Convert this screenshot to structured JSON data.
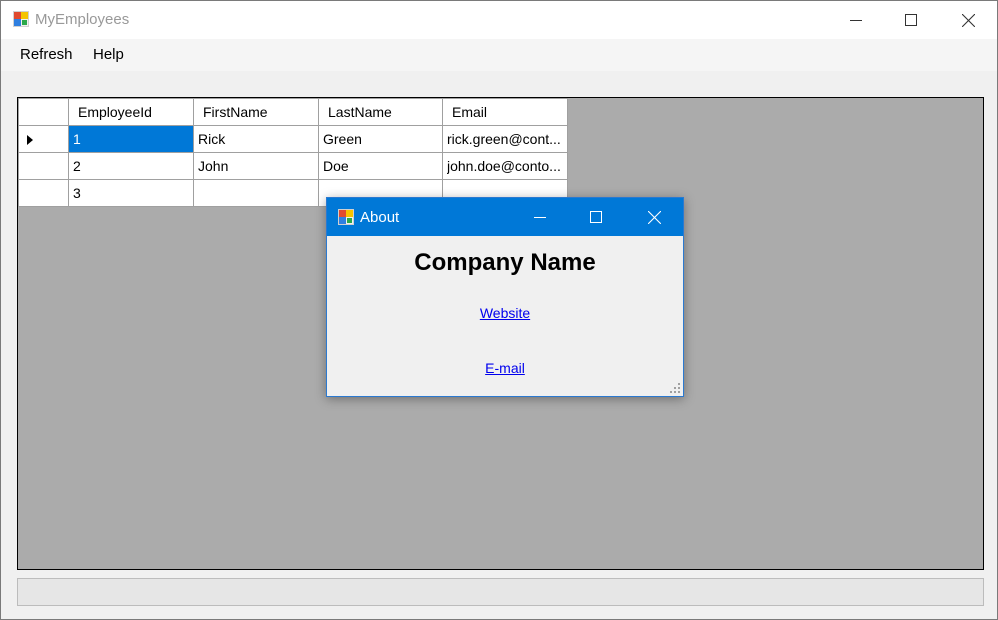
{
  "window": {
    "title": "MyEmployees"
  },
  "menu": {
    "items": [
      "Refresh",
      "Help"
    ]
  },
  "grid": {
    "columns": [
      "EmployeeId",
      "FirstName",
      "LastName",
      "Email"
    ],
    "rows": [
      {
        "id": "1",
        "first": "Rick",
        "last": "Green",
        "email": "rick.green@cont..."
      },
      {
        "id": "2",
        "first": "John",
        "last": "Doe",
        "email": "john.doe@conto..."
      },
      {
        "id": "3",
        "first": "",
        "last": "",
        "email": ""
      }
    ],
    "selected_row": 0
  },
  "dialog": {
    "title": "About",
    "company": "Company Name",
    "website_label": "Website",
    "email_label": "E-mail"
  },
  "colors": {
    "accent": "#0078d7",
    "grid_background": "#ababab",
    "link": "#0000ee"
  },
  "icons": {
    "app": "app-window-icon",
    "minimize": "minimize-icon",
    "maximize": "maximize-icon",
    "close": "close-icon",
    "row_pointer": "row-pointer-icon",
    "size_grip": "resize-grip-icon"
  }
}
